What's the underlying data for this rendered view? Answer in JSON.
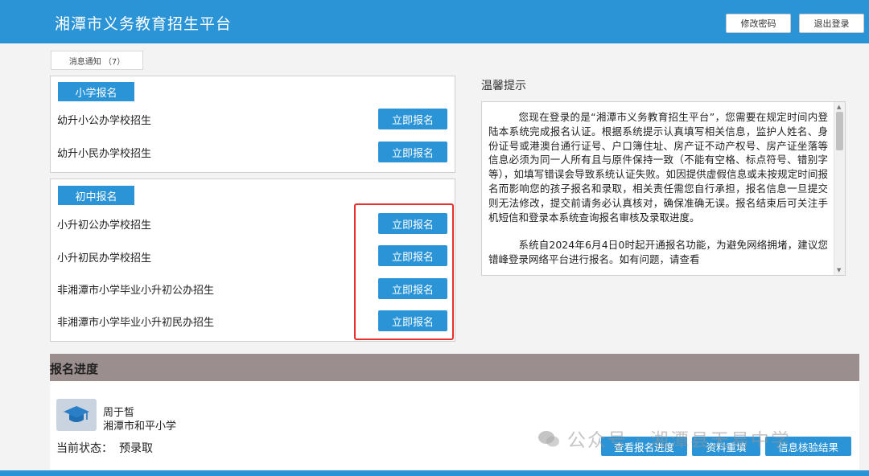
{
  "header": {
    "title": "湘潭市义务教育招生平台",
    "change_password": "修改密码",
    "logout": "退出登录"
  },
  "tab": {
    "label": "消息通知 （7）"
  },
  "primary": {
    "title": "小学报名",
    "rows": [
      {
        "label": "幼升小公办学校招生",
        "button": "立即报名"
      },
      {
        "label": "幼升小民办学校招生",
        "button": "立即报名"
      }
    ]
  },
  "middle": {
    "title": "初中报名",
    "rows": [
      {
        "label": "小升初公办学校招生",
        "button": "立即报名"
      },
      {
        "label": "小升初民办学校招生",
        "button": "立即报名"
      },
      {
        "label": "非湘潭市小学毕业小升初公办招生",
        "button": "立即报名"
      },
      {
        "label": "非湘潭市小学毕业小升初民办招生",
        "button": "立即报名"
      }
    ]
  },
  "tips": {
    "title": "温馨提示",
    "p1": "您现在登录的是“湘潭市义务教育招生平台”，您需要在规定时间内登陆本系统完成报名认证。根据系统提示认真填写相关信息，监护人姓名、身份证号或港澳台通行证号、户口簿住址、房产证不动产权号、房产证坐落等信息必须为同一人所有且与原件保持一致（不能有空格、标点符号、错别字等），如填写错误会导致系统认证失败。如因提供虚假信息或未按规定时间报名而影响您的孩子报名和录取，相关责任需您自行承担，报名信息一旦提交则无法修改，提交前请务必认真核对，确保准确无误。报名结束后可关注手机短信和登录本系统查询报名审核及录取进度。",
    "p2": "系统自2024年6月4日0时起开通报名功能，为避免网络拥堵，建议您错峰登录网络平台进行报名。如有问题，请查看"
  },
  "progress": {
    "title": "报名进度",
    "student_name": "周于皙",
    "school": "湘潭市和平小学",
    "status_label": "当前状态：",
    "status_value": "预录取",
    "buttons": [
      "查看报名进度",
      "资料重填",
      "信息核验结果"
    ]
  },
  "watermark": "公众号 · 湘潭县天易中学",
  "colors": {
    "brand": "#2a94d6",
    "highlight": "#e5322d",
    "progress_header": "#9b8e8e"
  }
}
